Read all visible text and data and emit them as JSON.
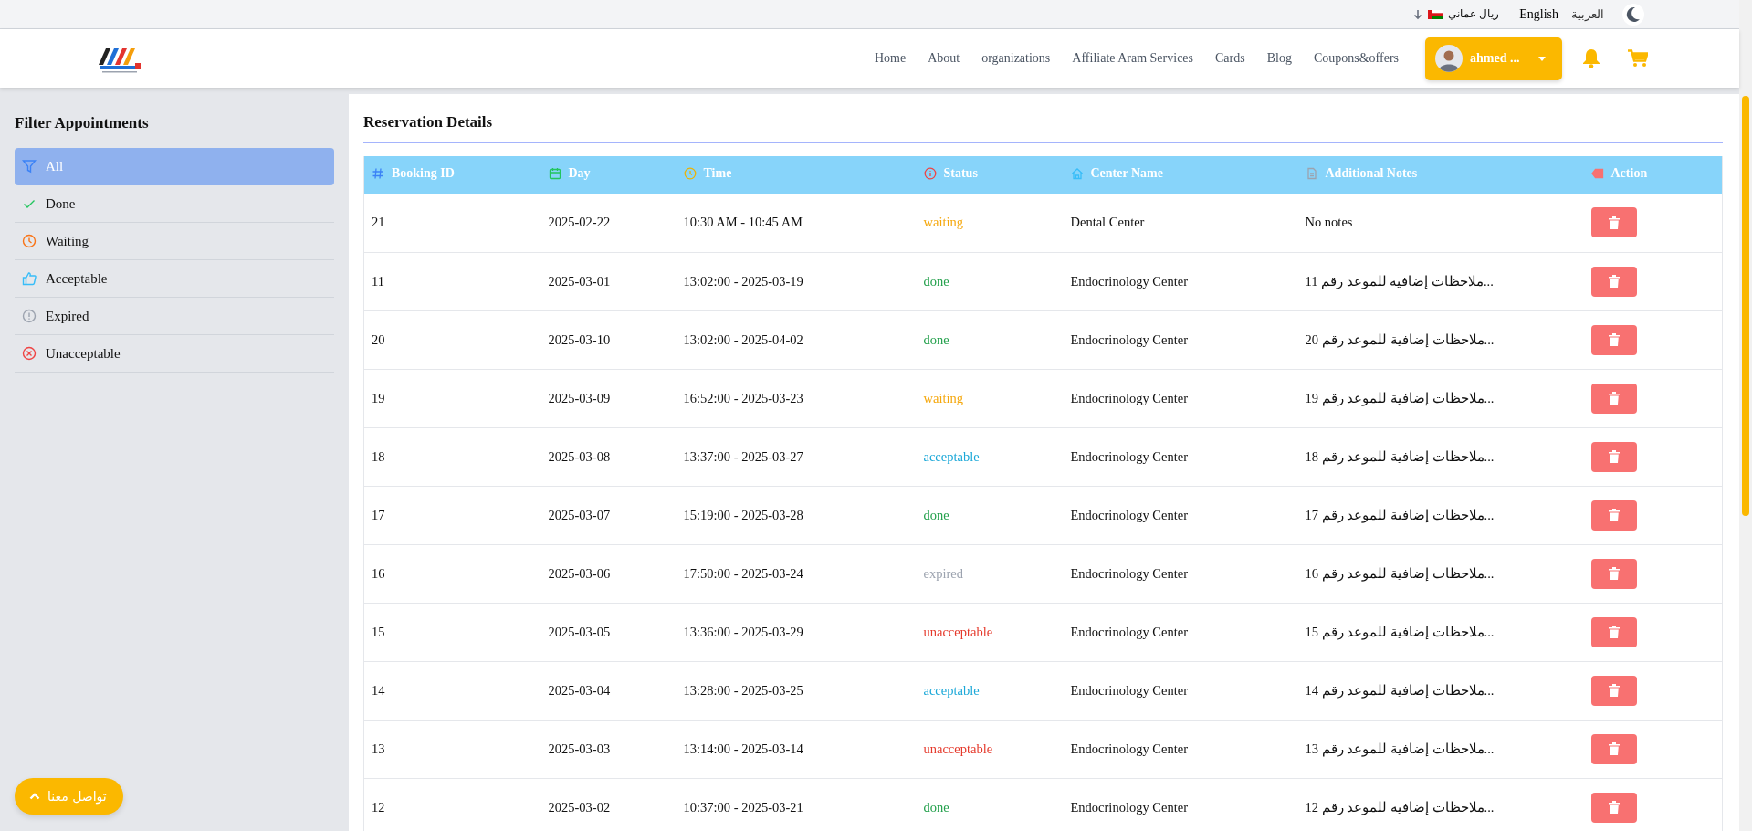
{
  "topbar": {
    "currency": "ريال عماني",
    "languages": [
      {
        "label": "English",
        "selected": true
      },
      {
        "label": "العربية",
        "selected": false
      }
    ]
  },
  "nav": {
    "links": [
      "Home",
      "About",
      "organizations",
      "Affiliate Aram Services",
      "Cards",
      "Blog",
      "Coupons&offers"
    ],
    "user": {
      "name": "ahmed ..."
    }
  },
  "sidebar": {
    "title": "Filter Appointments",
    "items": [
      {
        "label": "All",
        "kind": "all",
        "selected": true
      },
      {
        "label": "Done",
        "kind": "done",
        "selected": false
      },
      {
        "label": "Waiting",
        "kind": "waiting",
        "selected": false
      },
      {
        "label": "Acceptable",
        "kind": "acceptable",
        "selected": false
      },
      {
        "label": "Expired",
        "kind": "expired",
        "selected": false
      },
      {
        "label": "Unacceptable",
        "kind": "unacceptable",
        "selected": false
      }
    ]
  },
  "main": {
    "title": "Reservation Details",
    "table": {
      "columns": [
        "Booking ID",
        "Day",
        "Time",
        "Status",
        "Center Name",
        "Additional Notes",
        "Action"
      ],
      "rows": [
        {
          "id": "21",
          "day": "2025-02-22",
          "time": "10:30 AM - 10:45 AM",
          "status": {
            "label": "waiting",
            "color": "#f5a70b"
          },
          "center": "Dental Center",
          "notes": "No notes"
        },
        {
          "id": "11",
          "day": "2025-03-01",
          "time": "13:02:00 - 2025-03-19",
          "status": {
            "label": "done",
            "color": "#22a04b"
          },
          "center": "Endocrinology Center",
          "notes": "ملاحظات إضافية للموعد رقم 11..."
        },
        {
          "id": "20",
          "day": "2025-03-10",
          "time": "13:02:00 - 2025-04-02",
          "status": {
            "label": "done",
            "color": "#22a04b"
          },
          "center": "Endocrinology Center",
          "notes": "ملاحظات إضافية للموعد رقم 20..."
        },
        {
          "id": "19",
          "day": "2025-03-09",
          "time": "16:52:00 - 2025-03-23",
          "status": {
            "label": "waiting",
            "color": "#f5a70b"
          },
          "center": "Endocrinology Center",
          "notes": "ملاحظات إضافية للموعد رقم 19..."
        },
        {
          "id": "18",
          "day": "2025-03-08",
          "time": "13:37:00 - 2025-03-27",
          "status": {
            "label": "acceptable",
            "color": "#1ba8d8"
          },
          "center": "Endocrinology Center",
          "notes": "ملاحظات إضافية للموعد رقم 18..."
        },
        {
          "id": "17",
          "day": "2025-03-07",
          "time": "15:19:00 - 2025-03-28",
          "status": {
            "label": "done",
            "color": "#22a04b"
          },
          "center": "Endocrinology Center",
          "notes": "ملاحظات إضافية للموعد رقم 17..."
        },
        {
          "id": "16",
          "day": "2025-03-06",
          "time": "17:50:00 - 2025-03-24",
          "status": {
            "label": "expired",
            "color": "#9ca3af"
          },
          "center": "Endocrinology Center",
          "notes": "ملاحظات إضافية للموعد رقم 16..."
        },
        {
          "id": "15",
          "day": "2025-03-05",
          "time": "13:36:00 - 2025-03-29",
          "status": {
            "label": "unacceptable",
            "color": "#e5392b"
          },
          "center": "Endocrinology Center",
          "notes": "ملاحظات إضافية للموعد رقم 15..."
        },
        {
          "id": "14",
          "day": "2025-03-04",
          "time": "13:28:00 - 2025-03-25",
          "status": {
            "label": "acceptable",
            "color": "#1ba8d8"
          },
          "center": "Endocrinology Center",
          "notes": "ملاحظات إضافية للموعد رقم 14..."
        },
        {
          "id": "13",
          "day": "2025-03-03",
          "time": "13:14:00 - 2025-03-14",
          "status": {
            "label": "unacceptable",
            "color": "#e5392b"
          },
          "center": "Endocrinology Center",
          "notes": "ملاحظات إضافية للموعد رقم 13..."
        },
        {
          "id": "12",
          "day": "2025-03-02",
          "time": "10:37:00 - 2025-03-21",
          "status": {
            "label": "done",
            "color": "#22a04b"
          },
          "center": "Endocrinology Center",
          "notes": "ملاحظات إضافية للموعد رقم 12..."
        }
      ]
    }
  },
  "contact_button": {
    "label": "تواصل معنا"
  }
}
